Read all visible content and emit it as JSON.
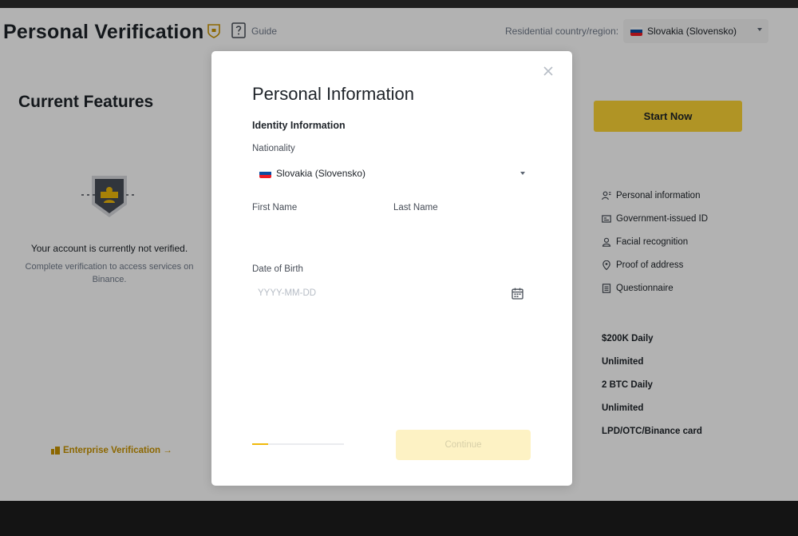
{
  "header": {
    "title": "Personal Verification",
    "guide_label": "Guide",
    "residential_label": "Residential country/region:",
    "country": "Slovakia (Slovensko)"
  },
  "left_panel": {
    "title": "Current Features",
    "status_text": "Your account is currently not verified.",
    "description": "Complete verification to access services on Binance.",
    "enterprise_link": "Enterprise Verification →"
  },
  "right_panel": {
    "start_button": "Start Now",
    "requirements": [
      {
        "icon": "person-info-icon",
        "label": "Personal information"
      },
      {
        "icon": "id-card-icon",
        "label": "Government-issued ID"
      },
      {
        "icon": "face-icon",
        "label": "Facial recognition"
      },
      {
        "icon": "location-pin-icon",
        "label": "Proof of address"
      },
      {
        "icon": "questionnaire-icon",
        "label": "Questionnaire"
      }
    ],
    "limits": [
      "$200K Daily",
      "Unlimited",
      "2 BTC Daily",
      "Unlimited",
      "LPD/OTC/Binance card"
    ]
  },
  "modal": {
    "title": "Personal Information",
    "section_title": "Identity Information",
    "nationality_label": "Nationality",
    "nationality_value": "Slovakia (Slovensko)",
    "first_name_label": "First Name",
    "first_name_value": "",
    "last_name_label": "Last Name",
    "last_name_value": "",
    "dob_label": "Date of Birth",
    "dob_placeholder": "YYYY-MM-DD",
    "progress_fraction": 0.17,
    "continue_label": "Continue"
  },
  "colors": {
    "brand_yellow": "#fcd535",
    "link_gold": "#c99400",
    "continue_disabled_bg": "#fdf2c4",
    "overlay": "rgba(0,0,0,0.30)"
  }
}
